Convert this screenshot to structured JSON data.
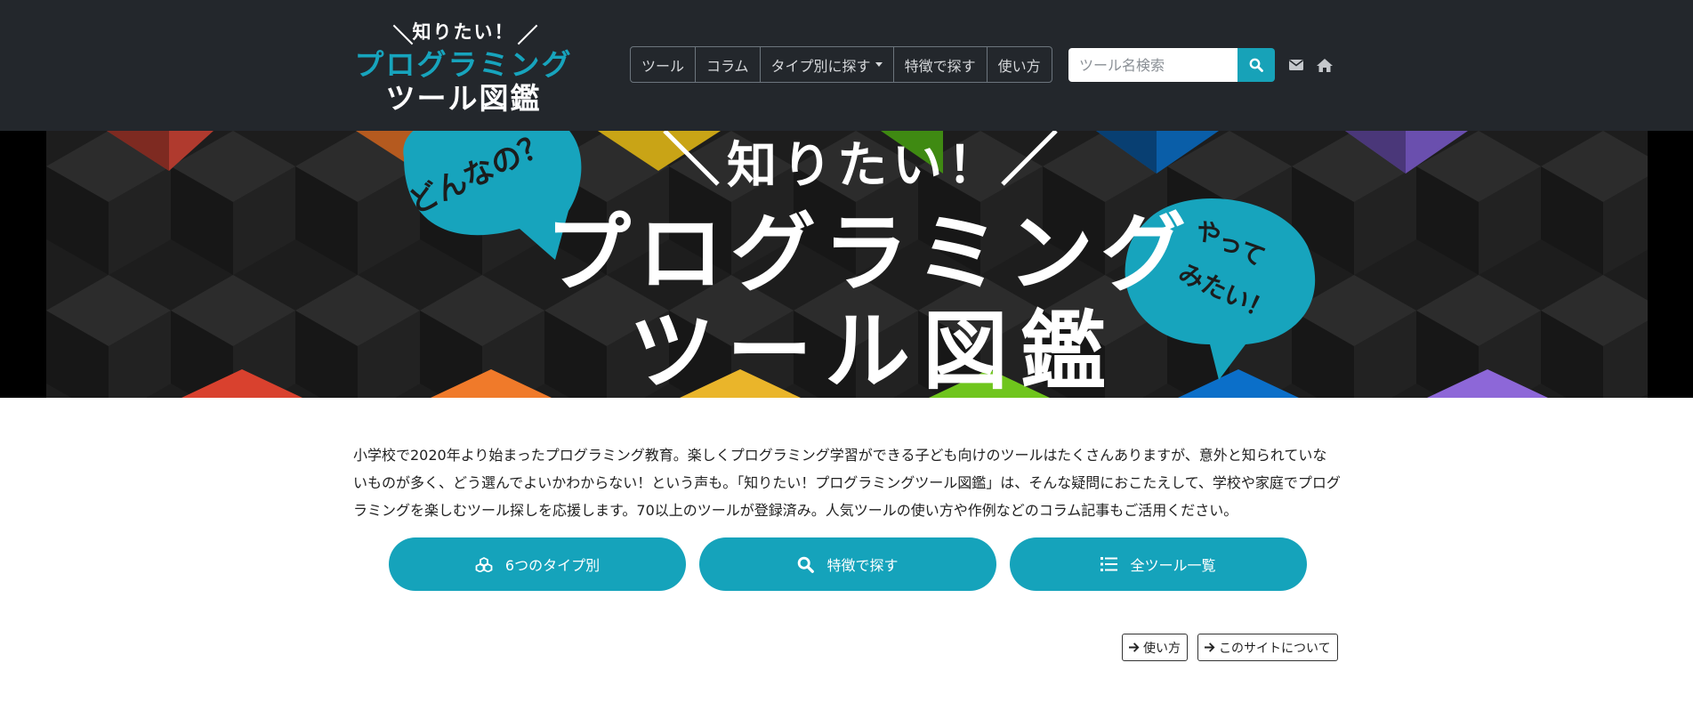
{
  "logo": {
    "line1": "知りたい！",
    "line2": "プログラミング",
    "line3": "ツール図鑑"
  },
  "nav": {
    "items": [
      {
        "label": "ツール"
      },
      {
        "label": "コラム"
      },
      {
        "label": "タイプ別に探す"
      },
      {
        "label": "特徴で探す"
      },
      {
        "label": "使い方"
      }
    ]
  },
  "search": {
    "placeholder": "ツール名検索"
  },
  "hero": {
    "title_small": "知りたい！",
    "title_main": "プログラミング",
    "title_sub": "ツール図鑑",
    "bubble_left": "どんなの？",
    "bubble_right_1": "やって",
    "bubble_right_2": "みたい！"
  },
  "intro": {
    "text": "小学校で2020年より始まったプログラミング教育。楽しくプログラミング学習ができる子ども向けのツールはたくさんありますが、意外と知られていないものが多く、どう選んでよいかわからない！という声も。「知りたい！プログラミングツール図鑑」は、そんな疑問におこたえして、学校や家庭でプログラミングを楽しむツール探しを応援します。70以上のツールが登録済み。人気ツールの使い方や作例などのコラム記事もご活用ください。"
  },
  "cta": {
    "types": "6つのタイプ別",
    "features": "特徴で探す",
    "all": "全ツール一覧"
  },
  "links": {
    "howto": "使い方",
    "about": "このサイトについて"
  },
  "colors": {
    "header_bg": "#23272c",
    "accent": "#17a2b8",
    "cube_colors": [
      "#c0392b",
      "#e67e22",
      "#f1c40f",
      "#52b81b",
      "#0a5ea8",
      "#7d58c4"
    ]
  },
  "icons": {
    "search_button": "search-icon",
    "mail": "envelope-icon",
    "home": "home-icon",
    "types": "cubes-icon",
    "features": "search-icon",
    "all": "list-icon",
    "links": "arrow-right-icon"
  }
}
